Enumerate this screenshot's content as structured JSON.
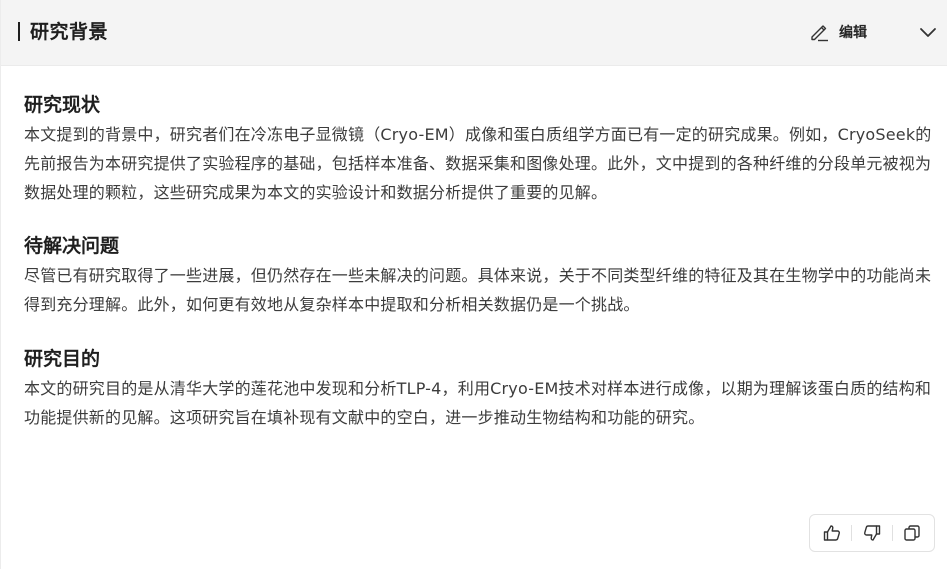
{
  "header": {
    "title": "研究背景",
    "edit_label": "编辑",
    "edit_icon": "pencil-icon",
    "collapse_icon": "chevron-down-icon"
  },
  "sections": [
    {
      "title": "研究现状",
      "body": "本文提到的背景中，研究者们在冷冻电子显微镜（Cryo-EM）成像和蛋白质组学方面已有一定的研究成果。例如，CryoSeek的先前报告为本研究提供了实验程序的基础，包括样本准备、数据采集和图像处理。此外，文中提到的各种纤维的分段单元被视为数据处理的颗粒，这些研究成果为本文的实验设计和数据分析提供了重要的见解。"
    },
    {
      "title": "待解决问题",
      "body": "尽管已有研究取得了一些进展，但仍然存在一些未解决的问题。具体来说，关于不同类型纤维的特征及其在生物学中的功能尚未得到充分理解。此外，如何更有效地从复杂样本中提取和分析相关数据仍是一个挑战。"
    },
    {
      "title": "研究目的",
      "body": "本文的研究目的是从清华大学的莲花池中发现和分析TLP-4，利用Cryo-EM技术对样本进行成像，以期为理解该蛋白质的结构和功能提供新的见解。这项研究旨在填补现有文献中的空白，进一步推动生物结构和功能的研究。"
    }
  ],
  "feedback": {
    "icons": [
      "thumbs-up-icon",
      "thumbs-down-icon",
      "copy-icon"
    ]
  }
}
